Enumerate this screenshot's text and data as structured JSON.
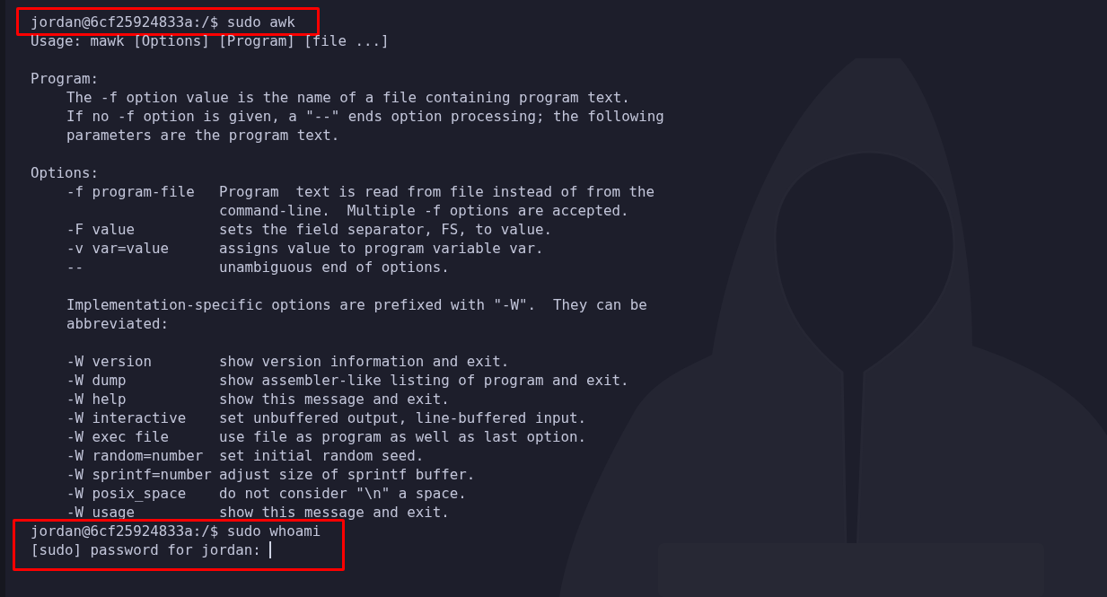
{
  "terminal": {
    "blocks": [
      {
        "highlighted": true,
        "lines": [
          {
            "kind": "prompt",
            "text": "jordan@6cf25924833a:/$ sudo awk"
          }
        ]
      },
      {
        "highlighted": false,
        "lines": [
          {
            "kind": "text",
            "text": "Usage: mawk [Options] [Program] [file ...]"
          },
          {
            "kind": "blank"
          },
          {
            "kind": "text",
            "text": "Program:"
          },
          {
            "kind": "indented",
            "text": "The -f option value is the name of a file containing program text."
          },
          {
            "kind": "indented",
            "text": "If no -f option is given, a \"--\" ends option processing; the following"
          },
          {
            "kind": "indented",
            "text": "parameters are the program text."
          },
          {
            "kind": "blank"
          },
          {
            "kind": "text",
            "text": "Options:"
          },
          {
            "kind": "option",
            "option": "-f program-file",
            "description": "Program  text is read from file instead of from the"
          },
          {
            "kind": "option",
            "description": "command-line.  Multiple -f options are accepted."
          },
          {
            "kind": "option",
            "option": "-F value",
            "description": "sets the field separator, FS, to value."
          },
          {
            "kind": "option",
            "option": "-v var=value",
            "description": "assigns value to program variable var."
          },
          {
            "kind": "option",
            "option": "--",
            "description": "unambiguous end of options."
          },
          {
            "kind": "blank"
          },
          {
            "kind": "indented",
            "text": "Implementation-specific options are prefixed with \"-W\".  They can be"
          },
          {
            "kind": "indented",
            "text": "abbreviated:"
          },
          {
            "kind": "blank"
          },
          {
            "kind": "option",
            "option": "-W version",
            "description": "show version information and exit."
          },
          {
            "kind": "option",
            "option": "-W dump",
            "description": "show assembler-like listing of program and exit."
          },
          {
            "kind": "option",
            "option": "-W help",
            "description": "show this message and exit."
          },
          {
            "kind": "option",
            "option": "-W interactive",
            "description": "set unbuffered output, line-buffered input."
          },
          {
            "kind": "option",
            "option": "-W exec file",
            "description": "use file as program as well as last option."
          },
          {
            "kind": "option",
            "option": "-W random=number",
            "description": "set initial random seed."
          },
          {
            "kind": "option",
            "option": "-W sprintf=number",
            "description": "adjust size of sprintf buffer."
          },
          {
            "kind": "option",
            "option": "-W posix_space",
            "description": "do not consider \"\\n\" a space."
          },
          {
            "kind": "option",
            "option": "-W usage",
            "description": "show this message and exit."
          }
        ]
      },
      {
        "highlighted": true,
        "lines": [
          {
            "kind": "prompt",
            "text": "jordan@6cf25924833a:/$ sudo whoami"
          },
          {
            "kind": "prompt",
            "text": "[sudo] password for jordan:",
            "cursor": true
          }
        ]
      }
    ]
  }
}
